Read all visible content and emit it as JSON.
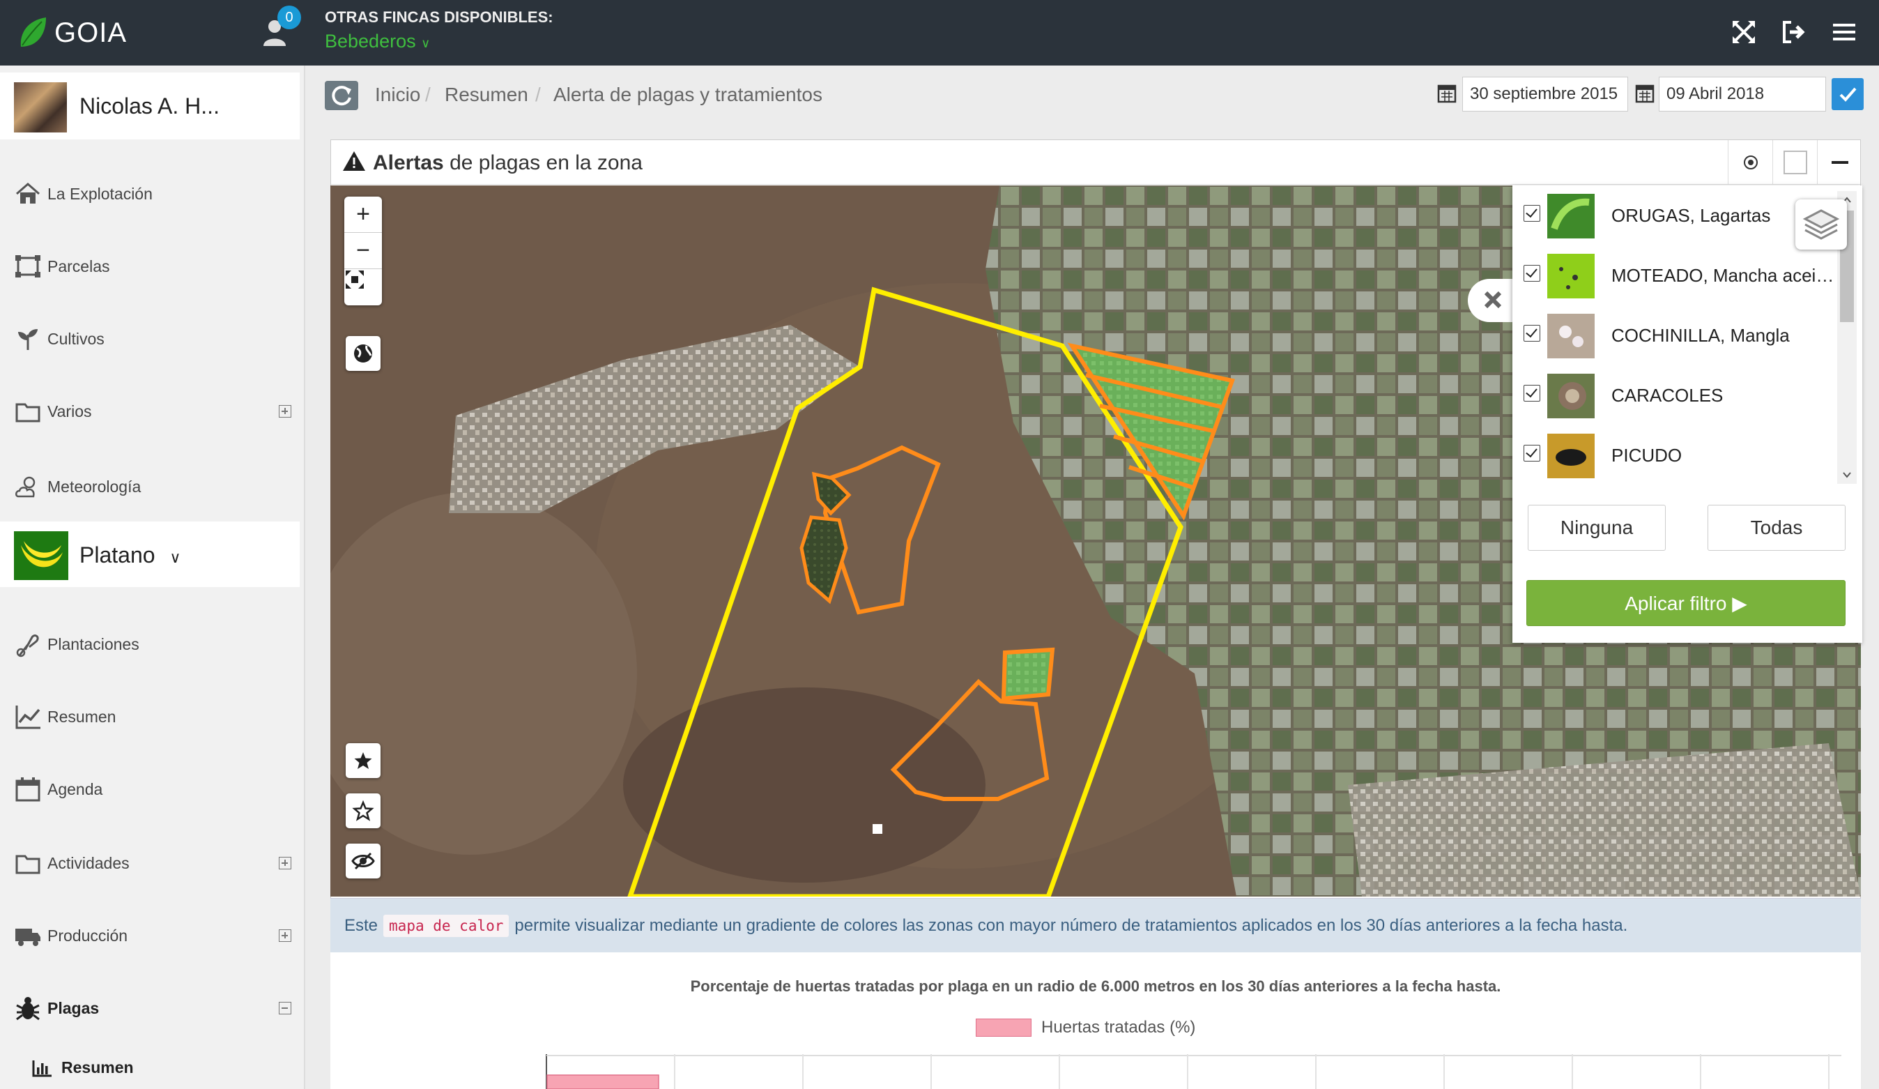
{
  "app": {
    "title": "GOIA"
  },
  "topbar": {
    "notif_count": "0",
    "farms_label": "OTRAS FINCAS DISPONIBLES:",
    "farms_selected": "Bebederos",
    "icons": [
      "expand-icon",
      "logout-icon",
      "menu-icon"
    ]
  },
  "sidebar": {
    "user_name": "Nicolas A. H...",
    "items": [
      {
        "label": "La Explotación",
        "icon": "home-icon"
      },
      {
        "label": "Parcelas",
        "icon": "parcels-icon"
      },
      {
        "label": "Cultivos",
        "icon": "plant-icon"
      },
      {
        "label": "Varios",
        "icon": "folder-icon"
      },
      {
        "label": "Meteorología",
        "icon": "weather-icon"
      }
    ],
    "crop": {
      "name": "Platano"
    },
    "crop_items": [
      {
        "label": "Plantaciones",
        "icon": "seedling-icon"
      },
      {
        "label": "Resumen",
        "icon": "line-chart-icon"
      },
      {
        "label": "Agenda",
        "icon": "calendar-icon"
      },
      {
        "label": "Actividades",
        "icon": "folder-icon"
      },
      {
        "label": "Producción",
        "icon": "truck-icon"
      },
      {
        "label": "Plagas",
        "icon": "bug-icon"
      }
    ],
    "sub_item": {
      "label": "Resumen",
      "icon": "bar-chart-icon"
    }
  },
  "breadcrumb": {
    "items": [
      "Inicio",
      "Resumen",
      "Alerta de plagas y tratamientos"
    ],
    "date_from": "30 septiembre 2015",
    "date_to": "09 Abril 2018"
  },
  "panel": {
    "title_bold": "Alertas",
    "title_rest": "de plagas en la zona"
  },
  "filter": {
    "pests": [
      {
        "label": "ORUGAS, Lagartas",
        "checked": true
      },
      {
        "label": "MOTEADO, Mancha aceitosa",
        "checked": true
      },
      {
        "label": "COCHINILLA, Mangla",
        "checked": true
      },
      {
        "label": "CARACOLES",
        "checked": true
      },
      {
        "label": "PICUDO",
        "checked": true
      }
    ],
    "none_label": "Ninguna",
    "all_label": "Todas",
    "apply_label": "Aplicar filtro ▶"
  },
  "info": {
    "before": "Este",
    "code": "mapa de calor",
    "after": "permite visualizar mediante un gradiente de colores las zonas con mayor número de tratamientos aplicados en los 30 días anteriores a la fecha hasta."
  },
  "chart": {
    "title": "Porcentaje de huertas tratadas por plaga en un radio de 6.000 metros en los 30 días anteriores a la fecha hasta.",
    "legend": "Huertas tratadas (%)"
  },
  "colors": {
    "topbar": "#2b333b",
    "accent_green": "#7ab33c",
    "primary_blue": "#2b8fd8",
    "farm_boundary": "#ffee00",
    "plot_outline": "#ff8c1a",
    "chart_bar": "#f7a4b3"
  }
}
